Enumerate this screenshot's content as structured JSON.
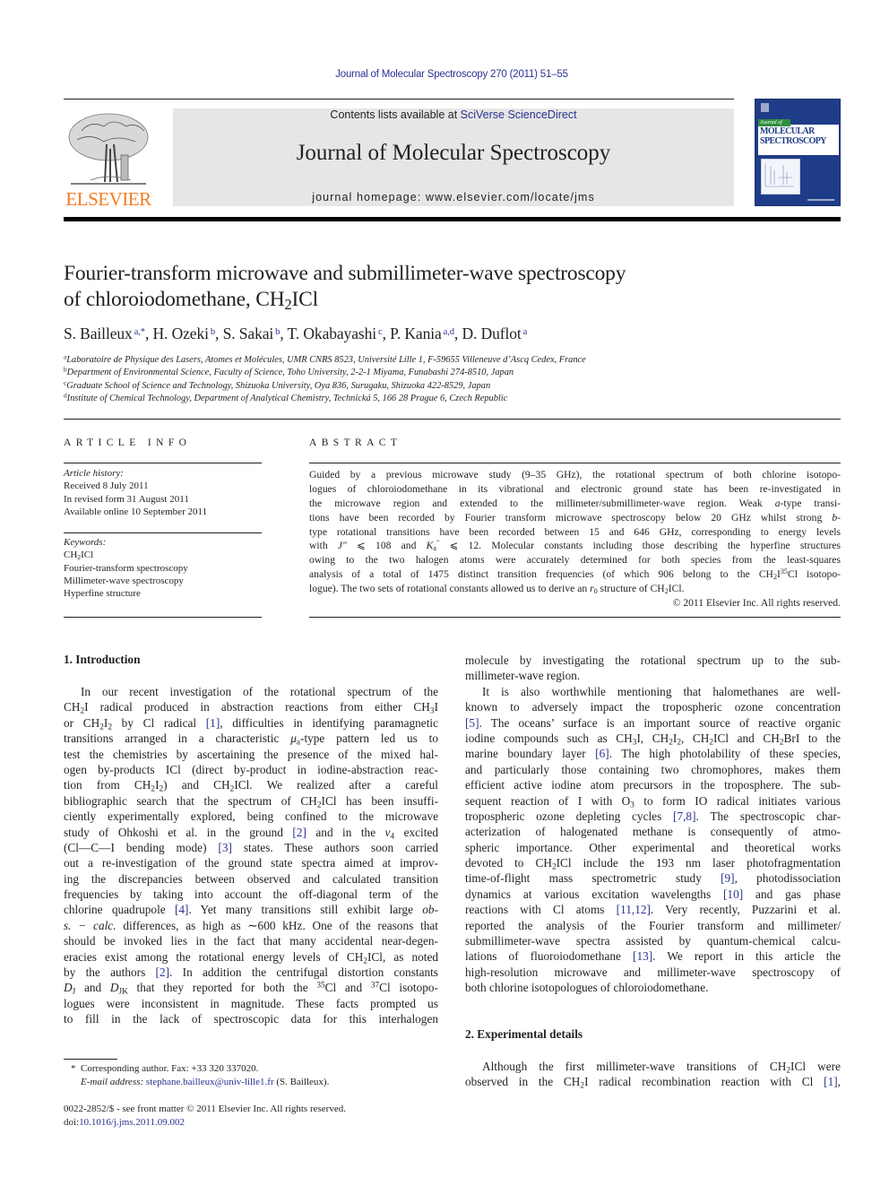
{
  "header": {
    "journal_ref": "Journal of Molecular Spectroscopy 270 (2011) 51–55",
    "contents_prefix": "Contents lists available at ",
    "contents_link": "SciVerse ScienceDirect",
    "journal_title": "Journal of Molecular Spectroscopy",
    "homepage_prefix": "journal homepage: ",
    "homepage_url": "www.elsevier.com/locate/jms",
    "publisher_logo_text": "ELSEVIER",
    "cover": {
      "journal_of": "Journal of",
      "name_line1": "MOLECULAR",
      "name_line2": "SPECTROSCOPY"
    }
  },
  "article": {
    "title_line1": "Fourier-transform microwave and submillimeter-wave spectroscopy",
    "title_line2": [
      {
        "t": "of chloroiodomethane, CH"
      },
      {
        "sub": "2"
      },
      {
        "t": "ICl"
      }
    ],
    "authors": [
      {
        "name": "S. Bailleux",
        "aff": "a,*"
      },
      {
        "name": "H. Ozeki",
        "aff": "b"
      },
      {
        "name": "S. Sakai",
        "aff": "b"
      },
      {
        "name": "T. Okabayashi",
        "aff": "c"
      },
      {
        "name": "P. Kania",
        "aff": "a,d"
      },
      {
        "name": "D. Duflot",
        "aff": "a"
      }
    ],
    "affiliations": [
      {
        "key": "a",
        "text": "Laboratoire de Physique des Lasers, Atomes et Molécules, UMR CNRS 8523, Université Lille 1, F-59655 Villeneuve d’Ascq Cedex, France"
      },
      {
        "key": "b",
        "text": "Department of Environmental Science, Faculty of Science, Toho University, 2-2-1 Miyama, Funabashi 274-8510, Japan"
      },
      {
        "key": "c",
        "text": "Graduate School of Science and Technology, Shizuoka University, Oya 836, Surugaku, Shizuoka 422-8529, Japan"
      },
      {
        "key": "d",
        "text": "Institute of Chemical Technology, Department of Analytical Chemistry, Technická 5, 166 28 Prague 6, Czech Republic"
      }
    ]
  },
  "article_info": {
    "heading": "ARTICLE INFO",
    "history_label": "Article history:",
    "history": [
      "Received 8 July 2011",
      "In revised form 31 August 2011",
      "Available online 10 September 2011"
    ],
    "keywords_label": "Keywords:",
    "keywords": [
      [
        {
          "t": "CH"
        },
        {
          "sub": "2"
        },
        {
          "t": "ICl"
        }
      ],
      [
        {
          "t": "Fourier-transform spectroscopy"
        }
      ],
      [
        {
          "t": "Millimeter-wave spectroscopy"
        }
      ],
      [
        {
          "t": "Hyperfine structure"
        }
      ]
    ]
  },
  "abstract": {
    "heading": "ABSTRACT",
    "lines": [
      [
        {
          "t": "Guided by a previous microwave study (9–35 GHz), the rotational spectrum of both chlorine isotopo-"
        }
      ],
      [
        {
          "t": "logues of chloroiodomethane in its vibrational and electronic ground state has been re-investigated in"
        }
      ],
      [
        {
          "t": "the microwave region and extended to the millimeter/submillimeter-wave region. Weak "
        },
        {
          "i": "a"
        },
        {
          "t": "-type transi-"
        }
      ],
      [
        {
          "t": "tions have been recorded by Fourier transform microwave spectroscopy below 20 GHz whilst strong "
        },
        {
          "i": "b"
        },
        {
          "t": "-"
        }
      ],
      [
        {
          "t": "type rotational transitions have been recorded between 15 and 646 GHz, corresponding to energy levels"
        }
      ],
      [
        {
          "t": "with "
        },
        {
          "i": "J″"
        },
        {
          "t": " ⩽ 108 and "
        },
        {
          "i": "K"
        },
        {
          "sub": "a"
        },
        {
          "sup": "″"
        },
        {
          "t": " ⩽ 12. Molecular constants including those describing the hyperfine structures"
        }
      ],
      [
        {
          "t": "owing to the two halogen atoms were accurately determined for both species from the least-squares"
        }
      ],
      [
        {
          "t": "analysis of a total of 1475 distinct transition frequencies (of which 906 belong to the CH"
        },
        {
          "sub": "2"
        },
        {
          "t": "I"
        },
        {
          "sup": "35"
        },
        {
          "t": "Cl isotopo-"
        }
      ],
      [
        {
          "t": "logue). The two sets of rotational constants allowed us to derive an "
        },
        {
          "i": "r"
        },
        {
          "sub": "0"
        },
        {
          "t": " structure of CH"
        },
        {
          "sub": "2"
        },
        {
          "t": "ICl."
        }
      ]
    ],
    "copyright": "© 2011 Elsevier Inc. All rights reserved."
  },
  "sections": {
    "intro_heading": "1. Introduction",
    "intro_left_lines": [
      [
        {
          "t": "In our recent investigation of the rotational spectrum of the"
        }
      ],
      [
        {
          "t": "CH"
        },
        {
          "sub": "2"
        },
        {
          "t": "I radical produced in abstraction reactions from either CH"
        },
        {
          "sub": "3"
        },
        {
          "t": "I"
        }
      ],
      [
        {
          "t": "or CH"
        },
        {
          "sub": "2"
        },
        {
          "t": "I"
        },
        {
          "sub": "2"
        },
        {
          "t": " by Cl radical "
        },
        {
          "link": "[1]"
        },
        {
          "t": ", difficulties in identifying paramagnetic"
        }
      ],
      [
        {
          "t": "transitions arranged in a characteristic "
        },
        {
          "i": "μ"
        },
        {
          "sub": "a"
        },
        {
          "t": "-type pattern led us to"
        }
      ],
      [
        {
          "t": "test the chemistries by ascertaining the presence of the mixed hal-"
        }
      ],
      [
        {
          "t": "ogen by-products ICl (direct by-product in iodine-abstraction reac-"
        }
      ],
      [
        {
          "t": "tion from CH"
        },
        {
          "sub": "2"
        },
        {
          "t": "I"
        },
        {
          "sub": "2"
        },
        {
          "t": ") and CH"
        },
        {
          "sub": "2"
        },
        {
          "t": "ICl. We realized after a careful"
        }
      ],
      [
        {
          "t": "bibliographic search that the spectrum of CH"
        },
        {
          "sub": "2"
        },
        {
          "t": "ICl has been insuffi-"
        }
      ],
      [
        {
          "t": "ciently experimentally explored, being confined to the microwave"
        }
      ],
      [
        {
          "t": "study of Ohkoshi et al. in the ground "
        },
        {
          "link": "[2]"
        },
        {
          "t": " and in the "
        },
        {
          "i": "v"
        },
        {
          "sub": "4"
        },
        {
          "t": " excited"
        }
      ],
      [
        {
          "t": "(Cl—C—I bending mode) "
        },
        {
          "link": "[3]"
        },
        {
          "t": " states. These authors soon carried"
        }
      ],
      [
        {
          "t": "out a re-investigation of the ground state spectra aimed at improv-"
        }
      ],
      [
        {
          "t": "ing the discrepancies between observed and calculated transition"
        }
      ],
      [
        {
          "t": "frequencies by taking into account the off-diagonal term of the"
        }
      ],
      [
        {
          "t": "chlorine quadrupole "
        },
        {
          "link": "[4]"
        },
        {
          "t": ". Yet many transitions still exhibit large "
        },
        {
          "i": "ob-"
        }
      ],
      [
        {
          "i": "s. − calc."
        },
        {
          "t": " differences, as high as ∼600 kHz. One of the reasons that"
        }
      ],
      [
        {
          "t": "should be invoked lies in the fact that many accidental near-degen-"
        }
      ],
      [
        {
          "t": "eracies exist among the rotational energy levels of CH"
        },
        {
          "sub": "2"
        },
        {
          "t": "ICl, as noted"
        }
      ],
      [
        {
          "t": "by the authors "
        },
        {
          "link": "[2]"
        },
        {
          "t": ". In addition the centrifugal distortion constants"
        }
      ],
      [
        {
          "i": "D"
        },
        {
          "sub": "J"
        },
        {
          "t": " and "
        },
        {
          "i": "D"
        },
        {
          "sub": "JK"
        },
        {
          "t": " that they reported for both the "
        },
        {
          "sup": "35"
        },
        {
          "t": "Cl and "
        },
        {
          "sup": "37"
        },
        {
          "t": "Cl isotopo-"
        }
      ],
      [
        {
          "t": "logues were inconsistent in magnitude. These facts prompted us"
        }
      ],
      [
        {
          "t": "to fill in the lack of spectroscopic data for this interhalogen"
        }
      ]
    ],
    "intro_right_lines": [
      [
        {
          "t": "molecule by investigating the rotational spectrum up to the sub-"
        }
      ],
      {
        "last": true,
        "segs": [
          {
            "t": "millimeter-wave region."
          }
        ]
      },
      {
        "indent": true,
        "segs": [
          {
            "t": "It is also worthwhile mentioning that halomethanes are well-"
          }
        ]
      },
      [
        {
          "t": "known to adversely impact the tropospheric ozone concentration"
        }
      ],
      [
        {
          "link": "[5]"
        },
        {
          "t": ". The oceans’ surface is an important source of reactive organic"
        }
      ],
      [
        {
          "t": "iodine compounds such as CH"
        },
        {
          "sub": "3"
        },
        {
          "t": "I, CH"
        },
        {
          "sub": "2"
        },
        {
          "t": "I"
        },
        {
          "sub": "2"
        },
        {
          "t": ", CH"
        },
        {
          "sub": "2"
        },
        {
          "t": "ICl and CH"
        },
        {
          "sub": "2"
        },
        {
          "t": "BrI to the"
        }
      ],
      [
        {
          "t": "marine boundary layer "
        },
        {
          "link": "[6]"
        },
        {
          "t": ". The high photolability of these species,"
        }
      ],
      [
        {
          "t": "and particularly those containing two chromophores, makes them"
        }
      ],
      [
        {
          "t": "efficient active iodine atom precursors in the troposphere. The sub-"
        }
      ],
      [
        {
          "t": "sequent reaction of I with O"
        },
        {
          "sub": "3"
        },
        {
          "t": " to form IO radical initiates various"
        }
      ],
      [
        {
          "t": "tropospheric ozone depleting cycles "
        },
        {
          "link": "[7,8]"
        },
        {
          "t": ". The spectroscopic char-"
        }
      ],
      [
        {
          "t": "acterization of halogenated methane is consequently of atmo-"
        }
      ],
      [
        {
          "t": "spheric importance. Other experimental and theoretical works"
        }
      ],
      [
        {
          "t": "devoted to CH"
        },
        {
          "sub": "2"
        },
        {
          "t": "ICl include the 193 nm laser photofragmentation"
        }
      ],
      [
        {
          "t": "time-of-flight mass spectrometric study "
        },
        {
          "link": "[9]"
        },
        {
          "t": ", photodissociation"
        }
      ],
      [
        {
          "t": "dynamics at various excitation wavelengths "
        },
        {
          "link": "[10]"
        },
        {
          "t": " and gas phase"
        }
      ],
      [
        {
          "t": "reactions with Cl atoms "
        },
        {
          "link": "[11,12]"
        },
        {
          "t": ". Very recently, Puzzarini et al."
        }
      ],
      [
        {
          "t": "reported the analysis of the Fourier transform and millimeter/"
        }
      ],
      [
        {
          "t": "submillimeter-wave spectra assisted by quantum-chemical calcu-"
        }
      ],
      [
        {
          "t": "lations of fluoroiodomethane "
        },
        {
          "link": "[13]"
        },
        {
          "t": ". We report in this article the"
        }
      ],
      [
        {
          "t": "high-resolution microwave and millimeter-wave spectroscopy of"
        }
      ],
      {
        "last": true,
        "segs": [
          {
            "t": "both chlorine isotopologues of chloroiodomethane."
          }
        ]
      }
    ],
    "exp_heading": "2. Experimental details",
    "exp_lines": [
      {
        "indent": true,
        "segs": [
          {
            "t": "Although the first millimeter-wave transitions of CH"
          },
          {
            "sub": "2"
          },
          {
            "t": "ICl were"
          }
        ]
      },
      [
        {
          "t": "observed in the CH"
        },
        {
          "sub": "2"
        },
        {
          "t": "I radical recombination reaction with Cl "
        },
        {
          "link": "[1]"
        },
        {
          "t": ","
        }
      ]
    ]
  },
  "footnotes": {
    "corresponding_marker": "*",
    "corresponding_text": "Corresponding author. Fax: +33 320 337020.",
    "email_label": "E-mail address:",
    "email": "stephane.bailleux@univ-lille1.fr",
    "email_suffix": "(S. Bailleux).",
    "issn_line": "0022-2852/$ - see front matter © 2011 Elsevier Inc. All rights reserved.",
    "doi_prefix": "doi:",
    "doi": "10.1016/j.jms.2011.09.002"
  },
  "colors": {
    "link": "#2a3390",
    "elsevier_orange": "#f47b20",
    "banner_grey": "#e6e6e6",
    "cover_blue": "#1f3c88"
  }
}
